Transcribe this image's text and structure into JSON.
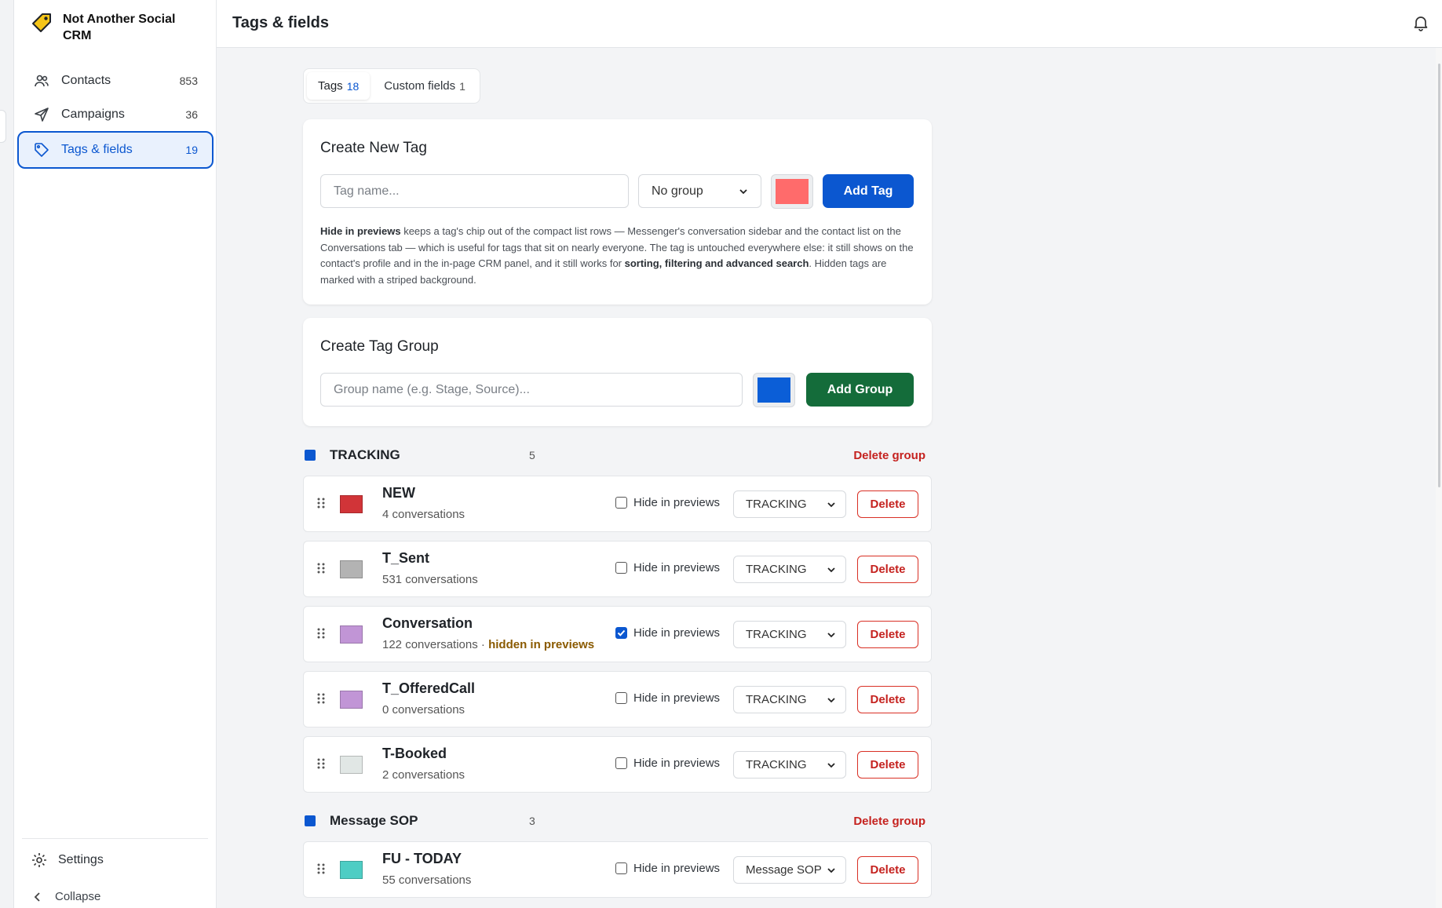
{
  "app": {
    "name": "Not Another Social CRM"
  },
  "sidebar": {
    "items": [
      {
        "label": "Contacts",
        "count": "853",
        "icon": "users-icon"
      },
      {
        "label": "Campaigns",
        "count": "36",
        "icon": "send-icon"
      },
      {
        "label": "Tags & fields",
        "count": "19",
        "icon": "tag-icon",
        "active": true
      }
    ],
    "settings_label": "Settings",
    "collapse_label": "Collapse"
  },
  "header": {
    "title": "Tags & fields"
  },
  "tabs": [
    {
      "label": "Tags",
      "count": "18",
      "active": true
    },
    {
      "label": "Custom fields",
      "count": "1",
      "active": false
    }
  ],
  "create_tag": {
    "title": "Create New Tag",
    "name_placeholder": "Tag name...",
    "group_value": "No group",
    "color": "#ff6b6b",
    "button": "Add Tag",
    "help": {
      "p1_bold": "Hide in previews",
      "p1": " keeps a tag's chip out of the compact list rows — Messenger's conversation sidebar and the contact list on the Conversations tab — which is useful for tags that sit on nearly everyone. The tag is untouched everywhere else: it still shows on the contact's profile and in the in-page CRM panel, and it still works for ",
      "p2_bold": "sorting, filtering and advanced search",
      "p2": ". Hidden tags are marked with a striped background."
    }
  },
  "create_group": {
    "title": "Create Tag Group",
    "name_placeholder": "Group name (e.g. Stage, Source)...",
    "color": "#0b5ed7",
    "button": "Add Group"
  },
  "groups": [
    {
      "name": "TRACKING",
      "count": "5",
      "delete_label": "Delete group",
      "tags": [
        {
          "name": "NEW",
          "meta": "4 conversations",
          "color": "#d13438",
          "hidden": false,
          "group": "TRACKING"
        },
        {
          "name": "T_Sent",
          "meta": "531 conversations",
          "color": "#b3b3b3",
          "hidden": false,
          "group": "TRACKING"
        },
        {
          "name": "Conversation",
          "meta": "122 conversations · ",
          "hidden_note": "hidden in previews",
          "color": "#c195d6",
          "hidden": true,
          "group": "TRACKING"
        },
        {
          "name": "T_OfferedCall",
          "meta": "0 conversations",
          "color": "#c195d6",
          "hidden": false,
          "group": "TRACKING"
        },
        {
          "name": "T-Booked",
          "meta": "2 conversations",
          "color": "#e1e7e5",
          "hidden": false,
          "group": "TRACKING"
        }
      ]
    },
    {
      "name": "Message SOP",
      "count": "3",
      "delete_label": "Delete group",
      "tags": [
        {
          "name": "FU - TODAY",
          "meta": "55 conversations",
          "color": "#4ecdc4",
          "hidden": false,
          "group": "Message SOP"
        }
      ]
    }
  ],
  "labels": {
    "hide_in_previews": "Hide in previews",
    "delete": "Delete"
  }
}
